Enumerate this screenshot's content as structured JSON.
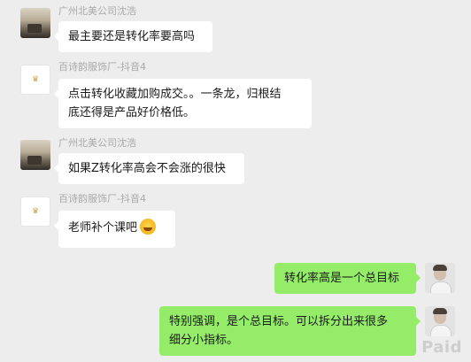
{
  "messages": [
    {
      "side": "left",
      "sender": "广州北美公司沈浩",
      "lines": [
        "最主要还是转化率要高吗"
      ]
    },
    {
      "side": "left",
      "sender": "百诗韵服饰厂-抖音4",
      "lines": [
        "点击转化收藏加购成交。。一条龙，归根结",
        "底还得是产品好价格低。"
      ]
    },
    {
      "side": "left",
      "sender": "广州北美公司沈浩",
      "lines": [
        "如果Z转化率高会不会涨的很快"
      ]
    },
    {
      "side": "left",
      "sender": "百诗韵服饰厂-抖音4",
      "lines": [
        "老师补个课吧"
      ],
      "emoji": "laughing-tears-emoji"
    },
    {
      "side": "right",
      "lines": [
        "转化率高是一个总目标"
      ]
    },
    {
      "side": "right",
      "lines": [
        "特别强调，是个总目标。可以拆分出来很多",
        "细分小指标。"
      ]
    }
  ],
  "watermark": "Paid",
  "colors": {
    "background": "#ededed",
    "left_bubble": "#ffffff",
    "right_bubble": "#95ec69",
    "name_text": "#a9a9a9"
  }
}
